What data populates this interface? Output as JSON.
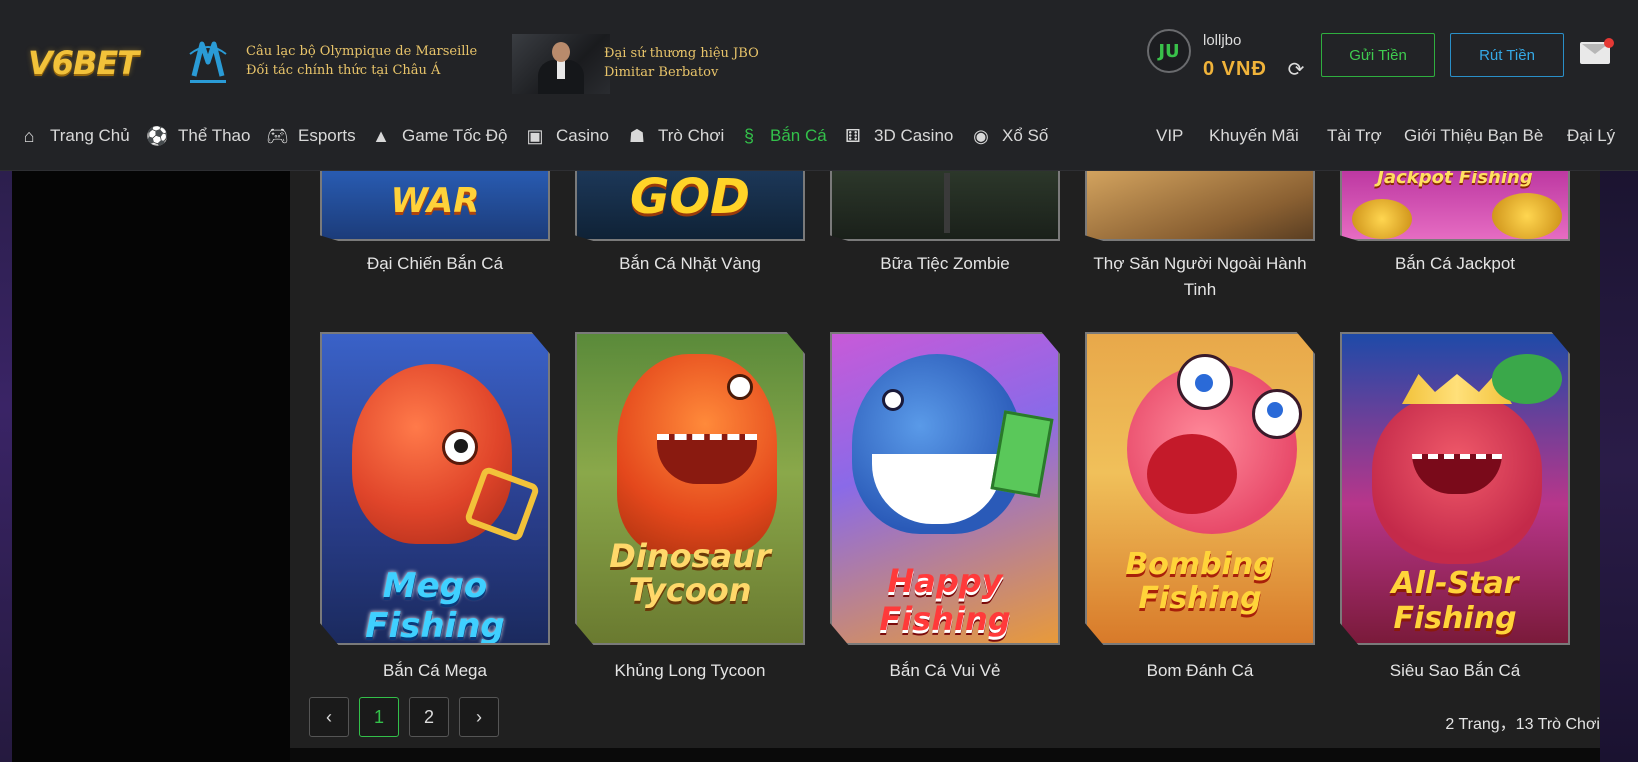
{
  "brand": {
    "logo_text": "V6BET"
  },
  "partner": {
    "line1": "Câu lạc bộ Olympique de Marseille",
    "line2": "Đối tác chính thức tại Châu Á"
  },
  "ambassador": {
    "line1": "Đại sứ thương hiệu JBO",
    "line2": "Dimitar Berbatov"
  },
  "user": {
    "avatar_text": "JU",
    "name": "lolljbo",
    "balance": "0  VNĐ"
  },
  "actions": {
    "deposit": "Gửi Tiền",
    "withdraw": "Rút Tiền"
  },
  "nav": {
    "left": [
      {
        "label": "Trang Chủ",
        "icon": "home-icon"
      },
      {
        "label": "Thể Thao",
        "icon": "soccer-ball-icon"
      },
      {
        "label": "Esports",
        "icon": "gamepad-icon"
      },
      {
        "label": "Game Tốc Độ",
        "icon": "speed-game-icon"
      },
      {
        "label": "Casino",
        "icon": "cards-icon"
      },
      {
        "label": "Trò Chơi",
        "icon": "arcade-icon"
      },
      {
        "label": "Bắn Cá",
        "icon": "fish-icon",
        "active": true
      },
      {
        "label": "3D Casino",
        "icon": "dice-icon"
      },
      {
        "label": "Xổ Số",
        "icon": "lottery-icon"
      }
    ],
    "right": [
      "VIP",
      "Khuyến Mãi",
      "Tài Trợ",
      "Giới Thiệu Bạn Bè",
      "Đại Lý"
    ]
  },
  "games_row1": [
    {
      "label": "Đại Chiến Bắn Cá",
      "art": "WAR"
    },
    {
      "label": "Bắn Cá Nhặt Vàng",
      "art": "GOD"
    },
    {
      "label": "Bữa Tiệc Zombie",
      "art": ""
    },
    {
      "label": "Thợ Săn Người Ngoài Hành Tinh",
      "art": ""
    },
    {
      "label": "Bắn Cá Jackpot",
      "art": "Jackpot Fishing"
    }
  ],
  "games_row2": [
    {
      "label": "Bắn Cá Mega",
      "art": "Mego Fishing"
    },
    {
      "label": "Khủng Long Tycoon",
      "art": "Dinosaur Tycoon"
    },
    {
      "label": "Bắn Cá Vui Vẻ",
      "art": "Happy Fishing"
    },
    {
      "label": "Bom Đánh Cá",
      "art": "Bombing Fishing"
    },
    {
      "label": "Siêu Sao Bắn Cá",
      "art": "All-Star Fishing"
    }
  ],
  "pagination": {
    "prev": "‹",
    "pages": [
      "1",
      "2"
    ],
    "next": "›",
    "summary": "2 Trang，13 Trò Chơi",
    "current_page": "1"
  },
  "colors": {
    "accent_green": "#33c04a",
    "accent_blue": "#35a9e6",
    "gold": "#f0b33a"
  }
}
